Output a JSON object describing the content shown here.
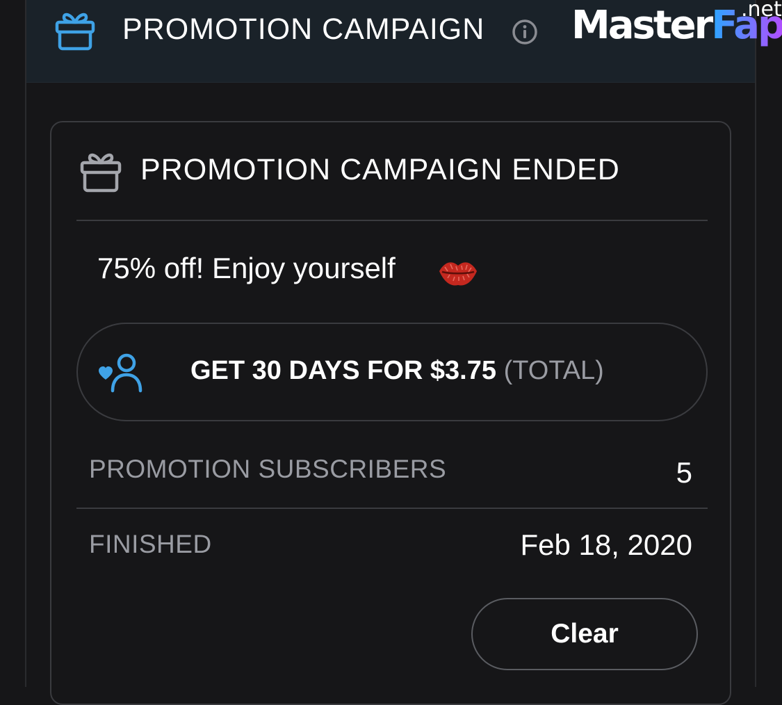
{
  "header": {
    "title": "PROMOTION CAMPAIGN",
    "icon": "gift-icon",
    "info_icon": "info-icon"
  },
  "watermark": {
    "part1": "Master",
    "part2": "Fap",
    "suffix": ".net"
  },
  "card": {
    "title": "PROMOTION CAMPAIGN ENDED",
    "icon": "gift-icon",
    "description": "75% off! Enjoy yourself",
    "description_emoji": "kiss-mark-icon",
    "offer": {
      "icon": "user-heart-icon",
      "text_main": "GET 30 DAYS FOR $3.75",
      "text_suffix": "(TOTAL)"
    },
    "stats": [
      {
        "label": "PROMOTION SUBSCRIBERS",
        "value": "5"
      },
      {
        "label": "FINISHED",
        "value": "Feb 18, 2020"
      }
    ],
    "clear_button": "Clear"
  },
  "colors": {
    "accent": "#3fa2e6",
    "background": "#161618",
    "header_bg": "#1a2229",
    "muted_text": "#9a9ca3",
    "border": "#3a3b3f"
  }
}
